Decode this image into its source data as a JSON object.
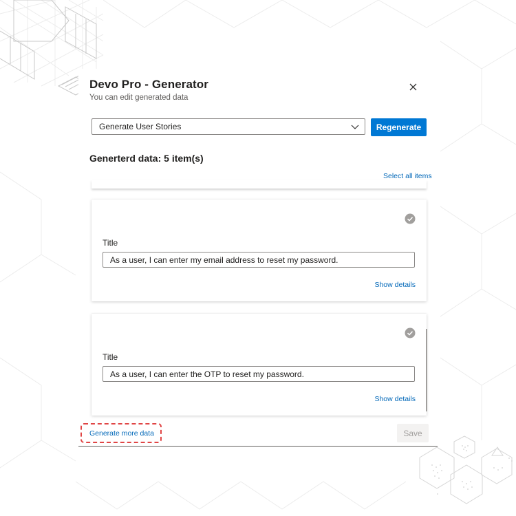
{
  "dialog": {
    "title": "Devo Pro - Generator",
    "subtitle": "You can edit generated data",
    "close_icon": "close-icon"
  },
  "generator": {
    "selected_option": "Generate User Stories",
    "regenerate_label": "Regenerate"
  },
  "results": {
    "count_label": "Generterd data: 5 item(s)",
    "select_all_label": "Select all items"
  },
  "cards": [
    {
      "title_label": "Title",
      "title_value": "As a user, I can enter my email address to reset my password.",
      "show_details_label": "Show details"
    },
    {
      "title_label": "Title",
      "title_value": "As a user, I can enter the OTP to reset my password.",
      "show_details_label": "Show details"
    }
  ],
  "footer": {
    "generate_more_label": "Generate more data",
    "save_label": "Save"
  },
  "colors": {
    "accent": "#0078d4",
    "link": "#0067b8",
    "highlight_dashed": "#e04545"
  }
}
